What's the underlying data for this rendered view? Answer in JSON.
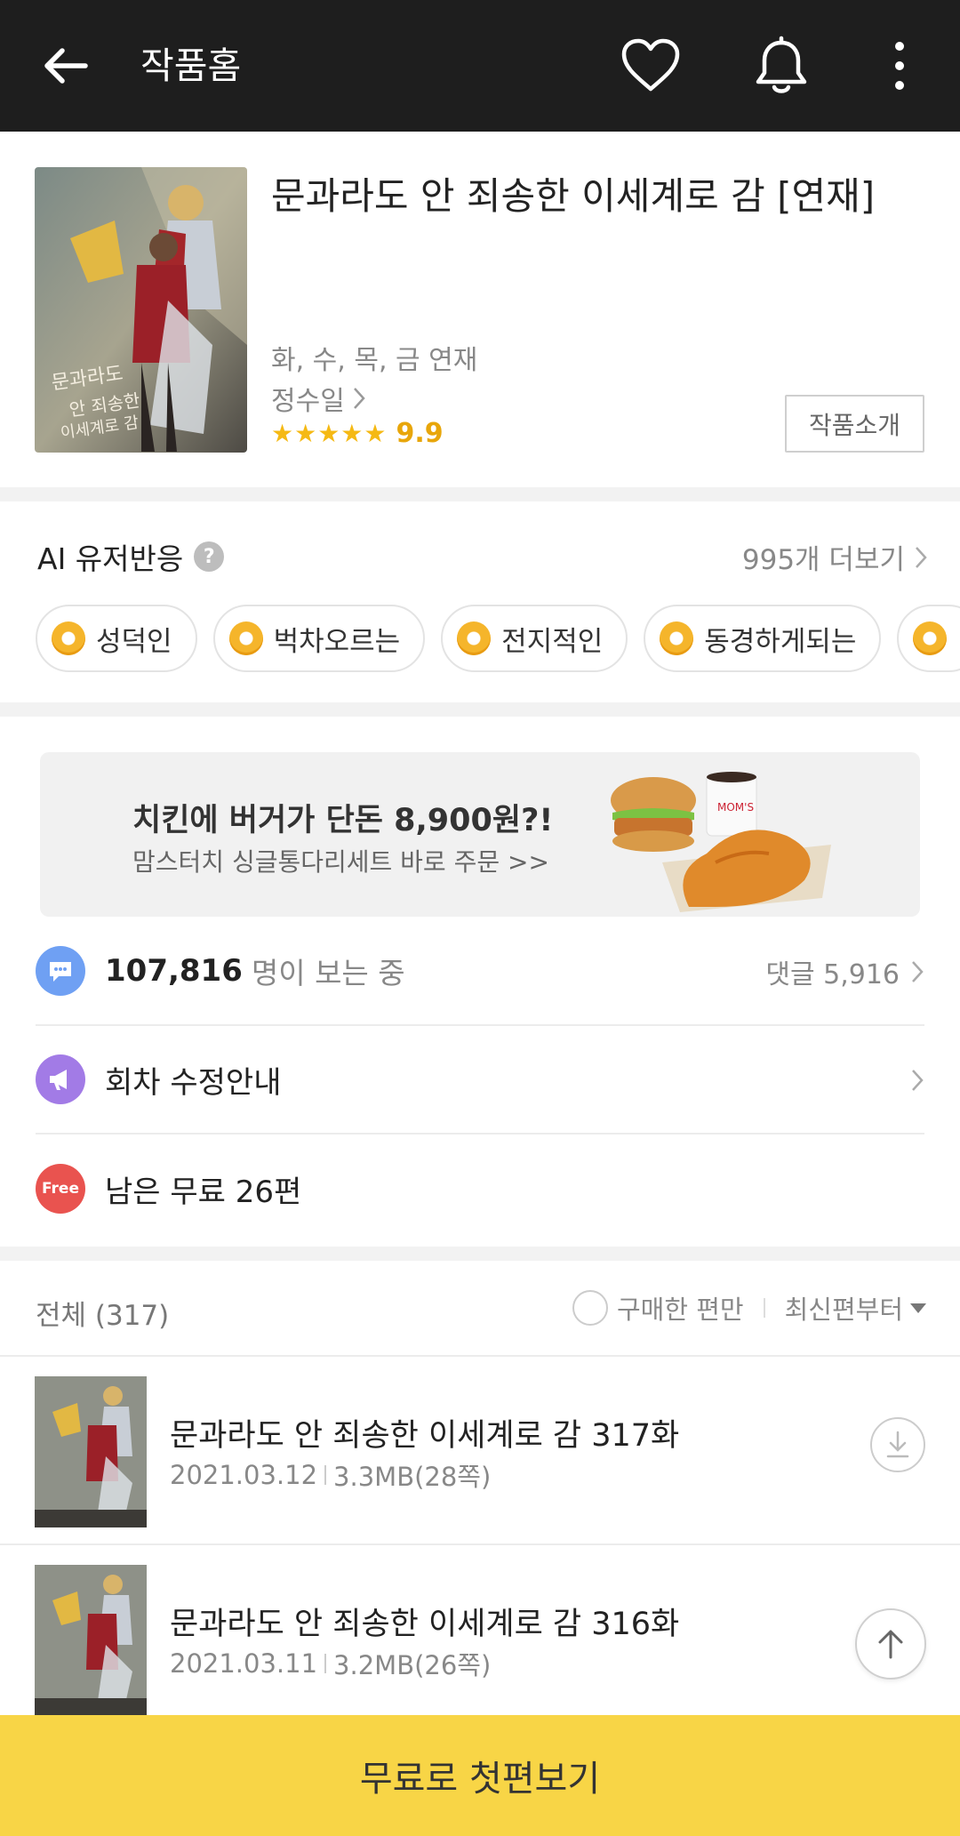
{
  "header": {
    "title": "작품홈"
  },
  "work": {
    "title": "문과라도 안 죄송한 이세계로 감 [연재]",
    "schedule": "화, 수, 목, 금 연재",
    "author": "정수일",
    "stars": "★★★★★",
    "rating": "9.9",
    "intro_button": "작품소개"
  },
  "ai": {
    "title": "AI 유저반응",
    "help": "?",
    "more": "995개 더보기",
    "chips": [
      "성덕인",
      "벅차오르는",
      "전지적인",
      "동경하게되는",
      ""
    ]
  },
  "ad": {
    "headline": "치킨에 버거가 단돈 8,900원?!",
    "sub": "맘스터치 싱글통다리세트 바로 주문 >>"
  },
  "viewers": {
    "count": "107,816",
    "suffix": "명이 보는 중",
    "comments": "댓글 5,916"
  },
  "notice": {
    "label": "회차 수정안내"
  },
  "free": {
    "badge": "Free",
    "label": "남은 무료 26편"
  },
  "list": {
    "all": "전체 (317)",
    "purchased_only": "구매한 편만",
    "sort": "최신편부터"
  },
  "episodes": [
    {
      "title": "문과라도 안 죄송한 이세계로 감 317화",
      "date": "2021.03.12",
      "size": "3.3MB(28쪽)"
    },
    {
      "title": "문과라도 안 죄송한 이세계로 감 316화",
      "date": "2021.03.11",
      "size": "3.2MB(26쪽)"
    }
  ],
  "cta": {
    "label": "무료로 첫편보기"
  },
  "colors": {
    "header_bg": "#1e1e1e",
    "accent_yellow": "#f8d546",
    "star": "#f5b914",
    "viewers_icon": "#6fa0f3",
    "notice_icon": "#a27be6",
    "free_icon": "#e9534f"
  },
  "icons": {
    "back": "arrow-left-icon",
    "heart": "heart-icon",
    "bell": "bell-icon",
    "more": "more-vertical-icon",
    "chat": "chat-icon",
    "megaphone": "megaphone-icon",
    "download": "download-icon",
    "scroll_top": "arrow-up-icon"
  }
}
